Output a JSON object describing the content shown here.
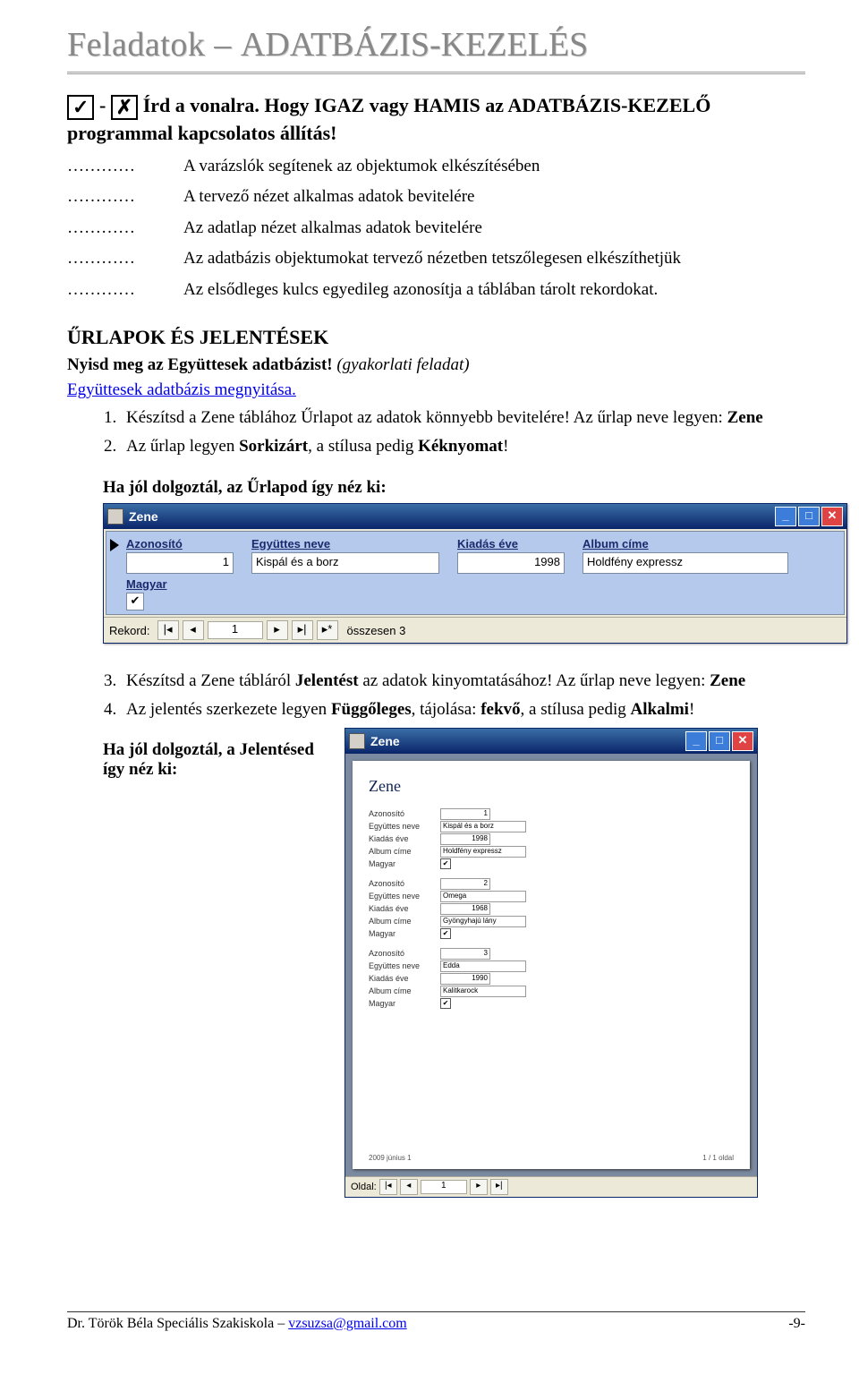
{
  "header": {
    "part1": "Feladatok – ",
    "part2": "ADATBÁZIS-KEZELÉS"
  },
  "task": {
    "check": "✓",
    "cross": "✗",
    "dash": " - ",
    "title_rest": " Írd a vonalra. Hogy IGAZ vagy HAMIS az ADATBÁZIS-KEZELŐ programmal kapcsolatos állítás!"
  },
  "dots": "…………",
  "statements": [
    "A varázslók segítenek az objektumok elkészítésében",
    "A tervező nézet alkalmas adatok bevitelére",
    "Az adatlap nézet alkalmas adatok bevitelére",
    "Az adatbázis objektumokat tervező nézetben tetszőlegesen elkészíthetjük",
    "Az elsődleges kulcs egyedileg azonosítja a táblában tárolt rekordokat."
  ],
  "section2": {
    "heading": "ŰRLAPOK ÉS JELENTÉSEK",
    "open_bold": "Nyisd meg az Együttesek adatbázist!",
    "open_ital": "(gyakorlati feladat)",
    "link": "Együttesek adatbázis megnyitása.",
    "items": [
      {
        "pre": "Készítsd a Zene táblához Űrlapot az adatok könnyebb bevitelére! Az űrlap neve legyen: ",
        "b": "Zene"
      },
      {
        "pre": "Az űrlap legyen ",
        "b1": "Sorkizárt",
        "mid": ", a stílusa pedig ",
        "b2": "Kéknyomat",
        "post": "!"
      }
    ],
    "result": "Ha jól dolgoztál, az Űrlapod így néz ki:"
  },
  "form": {
    "title": "Zene",
    "labels": {
      "id": "Azonosító",
      "band": "Együttes neve",
      "year": "Kiadás éve",
      "album": "Album címe",
      "hu": "Magyar"
    },
    "values": {
      "id": "1",
      "band": "Kispál és a borz",
      "year": "1998",
      "album": "Holdfény expressz",
      "hu": "✔"
    },
    "recordbar": {
      "label": "Rekord:",
      "num": "1",
      "total": "összesen 3"
    }
  },
  "section3": {
    "items": [
      {
        "n": "3.",
        "pre": "Készítsd a Zene tábláról ",
        "b1": "Jelentést",
        "mid": " az adatok kinyomtatásához! Az űrlap neve legyen: ",
        "b2": "Zene"
      },
      {
        "n": "4.",
        "pre": "Az jelentés szerkezete legyen ",
        "b1": "Függőleges",
        "mid": ", tájolása: ",
        "b2": "fekvő",
        "mid2": ", a stílusa pedig ",
        "b3": "Alkalmi",
        "post": "!"
      }
    ],
    "result": "Ha jól dolgoztál, a Jelentésed így néz ki:"
  },
  "report": {
    "title": "Zene",
    "page_title": "Zene",
    "labels": {
      "id": "Azonosító",
      "band": "Együttes neve",
      "year": "Kiadás éve",
      "album": "Album címe",
      "hu": "Magyar"
    },
    "records": [
      {
        "id": "1",
        "band": "Kispál és a borz",
        "year": "1998",
        "album": "Holdfény expressz",
        "hu": "✔"
      },
      {
        "id": "2",
        "band": "Omega",
        "year": "1968",
        "album": "Gyöngyhajú lány",
        "hu": "✔"
      },
      {
        "id": "3",
        "band": "Edda",
        "year": "1990",
        "album": "Kalitkarock",
        "hu": "✔"
      }
    ],
    "footer_date": "2009 június 1",
    "footer_page": "1 / 1 oldal",
    "nav": {
      "label": "Oldal:",
      "num": "1"
    }
  },
  "footer": {
    "left_a": "Dr. Török Béla Speciális Szakiskola – ",
    "email": "vzsuzsa@gmail.com",
    "right": "-9-"
  }
}
